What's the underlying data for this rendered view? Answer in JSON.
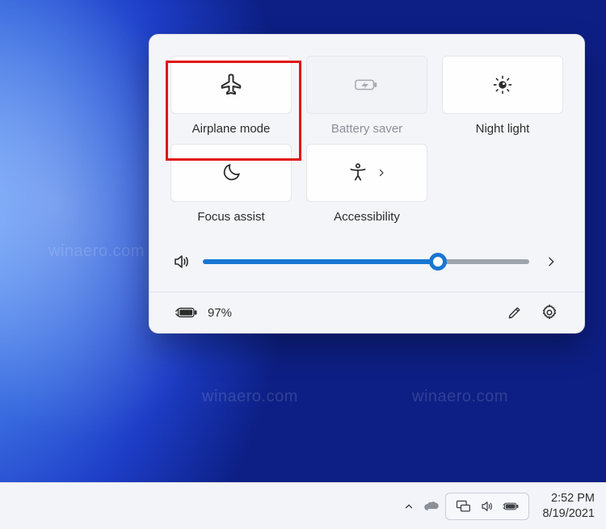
{
  "watermark_text": "winaero.com",
  "quick_settings": {
    "tiles": {
      "airplane": {
        "label": "Airplane mode"
      },
      "battery_saver": {
        "label": "Battery saver"
      },
      "night_light": {
        "label": "Night light"
      },
      "focus_assist": {
        "label": "Focus assist"
      },
      "accessibility": {
        "label": "Accessibility"
      }
    },
    "volume": {
      "percent": 72
    },
    "battery": {
      "text": "97%"
    }
  },
  "taskbar": {
    "time": "2:52 PM",
    "date": "8/19/2021"
  },
  "colors": {
    "accent": "#1976d2",
    "highlight": "#e11313"
  }
}
